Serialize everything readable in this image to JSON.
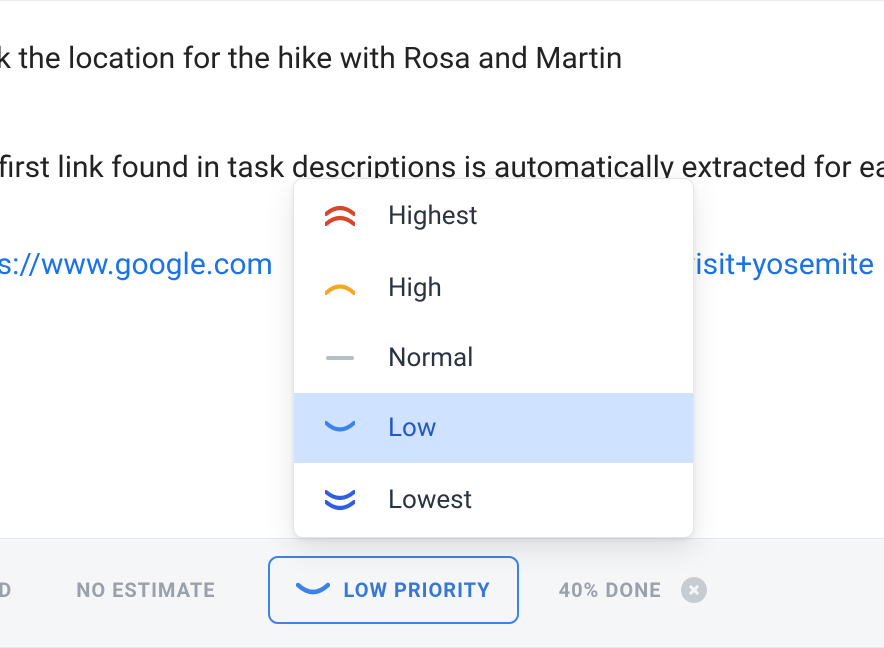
{
  "task": {
    "title": "ck the location for the hike with Rosa and Martin",
    "note": "he first link found in task descriptions is automatically extracted for ea",
    "link_left": "tps://www.google.com",
    "link_right": "visit+yosemite"
  },
  "priority_menu": {
    "items": [
      {
        "label": "Highest",
        "icon": "double-chevron-up",
        "color": "#d9472b"
      },
      {
        "label": "High",
        "icon": "chevron-up",
        "color": "#f5a623"
      },
      {
        "label": "Normal",
        "icon": "dash",
        "color": "#b7bdc6"
      },
      {
        "label": "Low",
        "icon": "chevron-down",
        "color": "#3b82e9",
        "selected": true
      },
      {
        "label": "Lowest",
        "icon": "double-chevron-down",
        "color": "#2f5fe0"
      }
    ]
  },
  "footer": {
    "truncated_pill_suffix": "ED",
    "no_estimate": "NO ESTIMATE",
    "priority_label": "LOW PRIORITY",
    "progress_label": "40% DONE"
  }
}
